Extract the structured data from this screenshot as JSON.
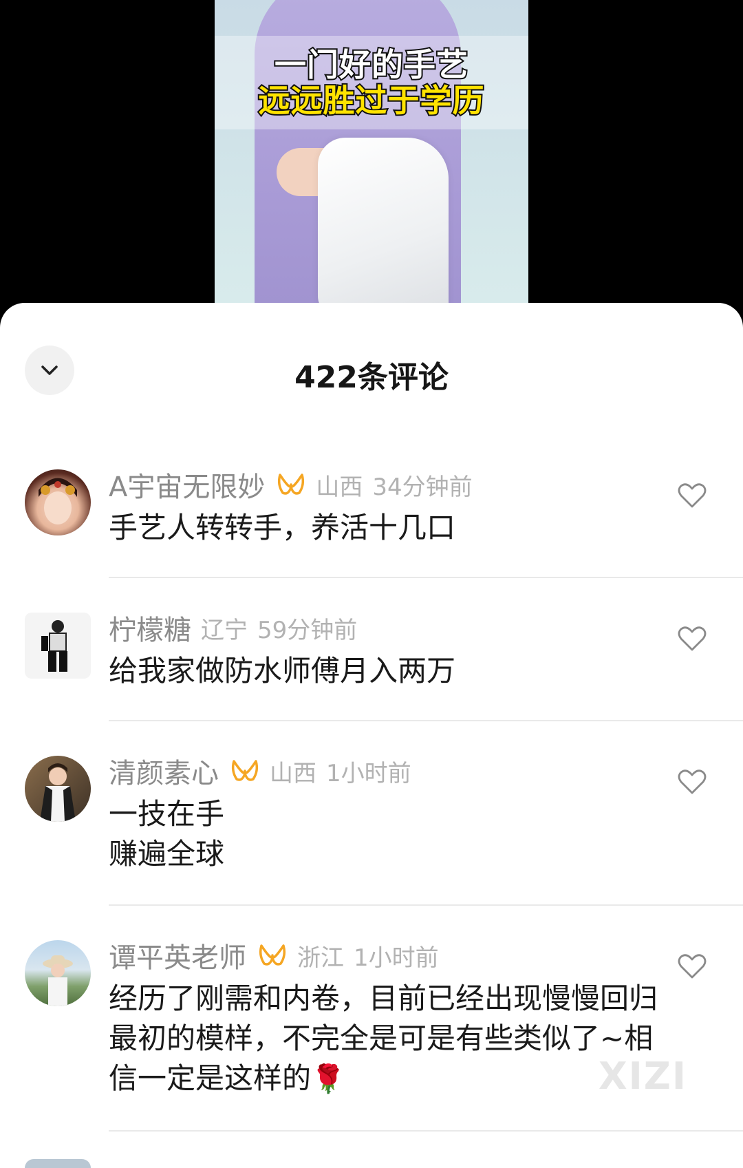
{
  "video": {
    "caption_line1": "一门好的手艺",
    "caption_line2": "远远胜过于学历"
  },
  "sheet": {
    "title": "422条评论",
    "collapse_icon": "chevron-down-icon"
  },
  "comments": [
    {
      "username": "A宇宙无限妙",
      "has_badge": true,
      "location": "山西",
      "time": "34分钟前",
      "text": "手艺人转转手，养活十几口"
    },
    {
      "username": "柠檬糖",
      "has_badge": false,
      "location": "辽宁",
      "time": "59分钟前",
      "text": "给我家做防水师傅月入两万"
    },
    {
      "username": "清颜素心",
      "has_badge": true,
      "location": "山西",
      "time": "1小时前",
      "text": "一技在手\n赚遍全球"
    },
    {
      "username": "谭平英老师",
      "has_badge": true,
      "location": "浙江",
      "time": "1小时前",
      "text": "经历了刚需和内卷，目前已经出现慢慢回归最初的模样，不完全是可是有些类似了~相信一定是这样的",
      "emoji": "🌹"
    }
  ],
  "watermark": "XIZI",
  "colors": {
    "badge": "#f5a623",
    "username": "#8a8a8a",
    "meta": "#b2b2b2",
    "text": "#1a1a1a"
  }
}
